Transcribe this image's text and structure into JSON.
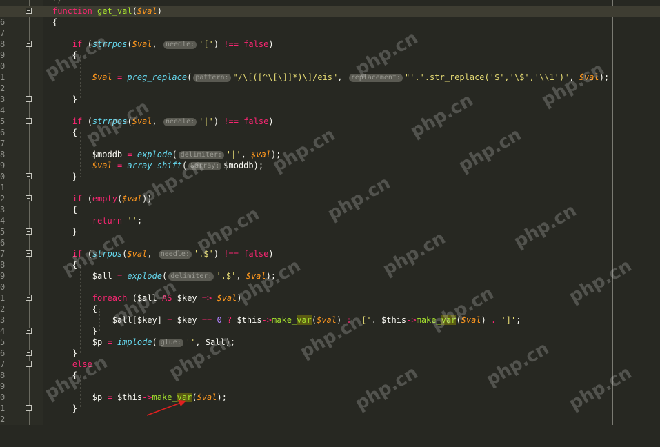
{
  "editor": {
    "line_numbers": [
      "6",
      "7",
      "8",
      "9",
      "0",
      "1",
      "2",
      "3",
      "4",
      "5",
      "6",
      "7",
      "8",
      "9",
      "0",
      "1",
      "2",
      "3",
      "4",
      "5",
      "6",
      "7",
      "8",
      "9",
      "0",
      "1",
      "2",
      "3",
      "4",
      "5",
      "6",
      "7",
      "8",
      "9",
      "0",
      "1",
      "2"
    ],
    "top_partial": "*/",
    "hints": {
      "needle": "needle:",
      "pattern": "pattern:",
      "replacement": "replacement:",
      "delimiter": "delimiter:",
      "array": "&array:",
      "glue": "glue:"
    }
  },
  "watermark": "php.cn",
  "colors": {
    "background": "#272822",
    "keyword": "#f92672",
    "variable": "#fd971f",
    "function": "#a6e22e",
    "string": "#e6db74",
    "arrow": "#e02020"
  }
}
